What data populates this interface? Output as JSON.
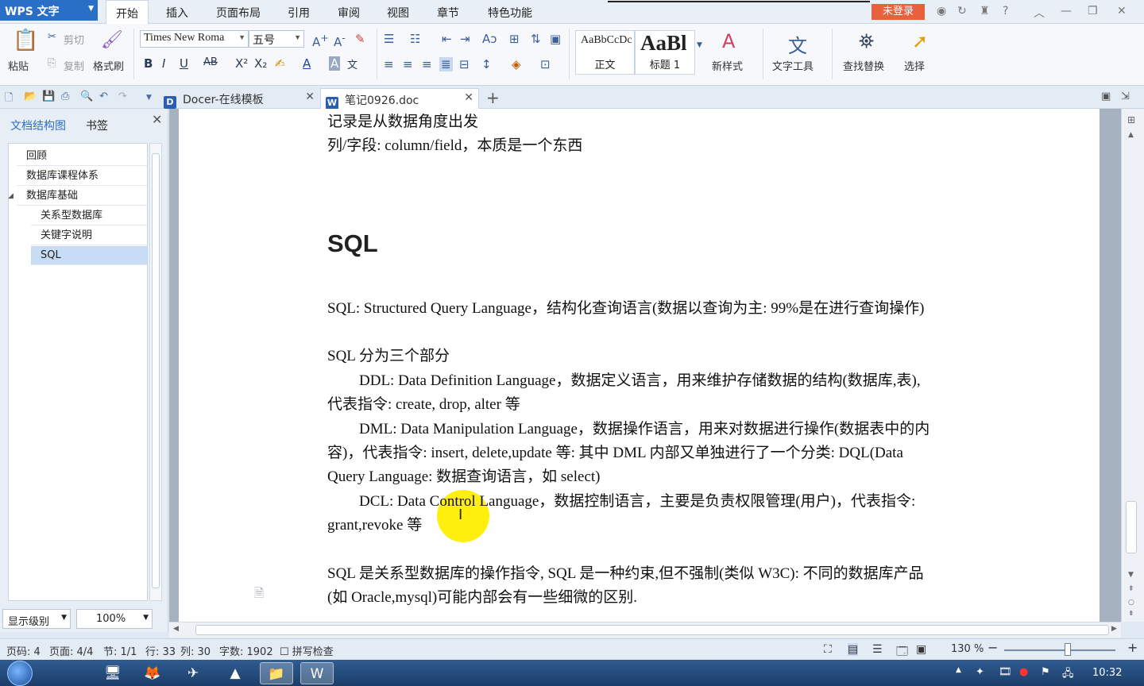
{
  "titlebar": {
    "app_name": "WPS 文字",
    "menus": [
      "开始",
      "插入",
      "页面布局",
      "引用",
      "审阅",
      "视图",
      "章节",
      "特色功能"
    ],
    "login": "未登录"
  },
  "ribbon": {
    "paste": "粘贴",
    "cut": "剪切",
    "copy": "复制",
    "format_painter": "格式刷",
    "font_name": "Times New Roma",
    "font_size": "五号",
    "styles": [
      {
        "preview": "AaBbCcDc",
        "label": "正文"
      },
      {
        "preview": "AaBl",
        "label": "标题 1"
      }
    ],
    "new_style": "新样式",
    "text_tools": "文字工具",
    "find_replace": "查找替换",
    "select": "选择"
  },
  "tabs": [
    {
      "label": "Docer-在线模板",
      "badge": "D"
    },
    {
      "label": "笔记0926.doc",
      "badge": "W"
    }
  ],
  "sidebar": {
    "tabs": [
      "文档结构图",
      "书签"
    ],
    "tree": [
      {
        "label": "回顾",
        "level": 1,
        "selected": false
      },
      {
        "label": "数据库课程体系",
        "level": 1,
        "selected": false
      },
      {
        "label": "数据库基础",
        "level": 1,
        "selected": false,
        "expanded": true
      },
      {
        "label": "关系型数据库",
        "level": 2,
        "selected": false
      },
      {
        "label": "关键字说明",
        "level": 2,
        "selected": false
      },
      {
        "label": "SQL",
        "level": 2,
        "selected": true
      }
    ],
    "level_select": "显示级别",
    "zoom_select": "100%"
  },
  "document": {
    "lines": [
      "记录是从数据角度出发",
      "列/字段: column/field，本质是一个东西"
    ],
    "heading": "SQL",
    "para1": "SQL: Structured Query Language，结构化查询语言(数据以查询为主: 99%是在进行查询操作)",
    "para2": "SQL 分为三个部分",
    "ddl_1": "DDL: Data Definition Language，数据定义语言，用来维护存储数据的结构(数据库,表),",
    "ddl_2": "代表指令: create, drop, alter 等",
    "dml_1": "DML: Data Manipulation Language，数据操作语言，用来对数据进行操作(数据表中的内",
    "dml_2": "容)，代表指令: insert, delete,update 等: 其中 DML 内部又单独进行了一个分类: DQL(Data",
    "dml_3": "Query Language: 数据查询语言，如 select)",
    "dcl_1": "DCL: Data Control Language，数据控制语言，主要是负责权限管理(用户)，代表指令:",
    "dcl_2": "grant,revoke 等",
    "para3_1": "SQL 是关系型数据库的操作指令, SQL 是一种约束,但不强制(类似 W3C): 不同的数据库产品",
    "para3_2": "(如 Oracle,mysql)可能内部会有一些细微的区别."
  },
  "statusbar": {
    "page_code": "页码: 4",
    "pages": "页面: 4/4",
    "section": "节: 1/1",
    "row": "行: 33",
    "col": "列: 30",
    "word_count": "字数: 1902",
    "spell_check": "拼写检查",
    "zoom": "130 %"
  },
  "taskbar": {
    "clock": "10:32"
  }
}
